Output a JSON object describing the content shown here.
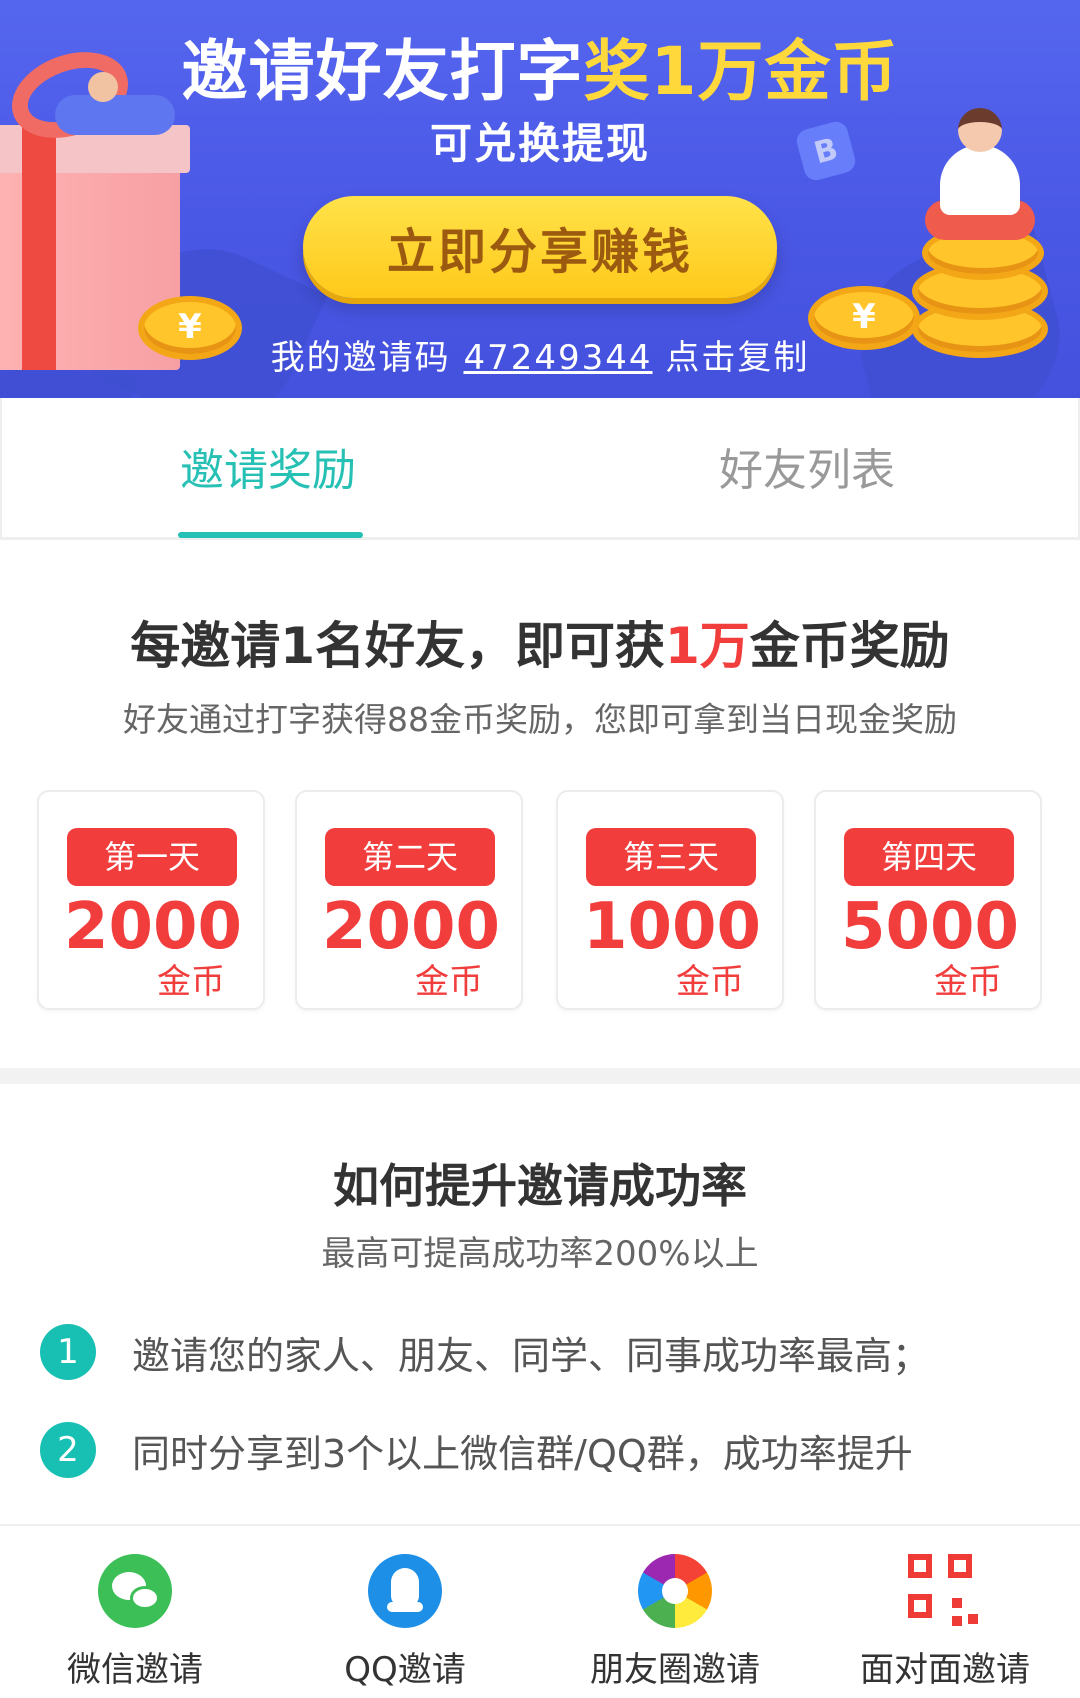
{
  "banner": {
    "title_main": "邀请好友打字",
    "title_highlight": "奖1万金币",
    "subtitle": "可兑换提现",
    "share_button": "立即分享赚钱",
    "invite_prefix": "我的邀请码",
    "invite_code": "47249344",
    "invite_suffix": "点击复制",
    "coin_symbol": "¥",
    "badge_letter": "B"
  },
  "tabs": [
    {
      "label": "邀请奖励",
      "active": true
    },
    {
      "label": "好友列表",
      "active": false
    }
  ],
  "reward": {
    "title_before": "每邀请1名好友，即可获",
    "title_highlight": "1万",
    "title_after": "金币奖励",
    "subtitle": "好友通过打字获得88金币奖励，您即可拿到当日现金奖励",
    "days": [
      {
        "label": "第一天",
        "amount": "2000",
        "unit": "金币"
      },
      {
        "label": "第二天",
        "amount": "2000",
        "unit": "金币"
      },
      {
        "label": "第三天",
        "amount": "1000",
        "unit": "金币"
      },
      {
        "label": "第四天",
        "amount": "5000",
        "unit": "金币"
      }
    ]
  },
  "tips": {
    "title": "如何提升邀请成功率",
    "subtitle": "最高可提高成功率200%以上",
    "items": [
      {
        "num": "1",
        "text": "邀请您的家人、朋友、同学、同事成功率最高；"
      },
      {
        "num": "2",
        "text": "同时分享到3个以上微信群/QQ群，成功率提升"
      }
    ]
  },
  "share_bar": [
    {
      "label": "微信邀请",
      "icon": "wechat-icon"
    },
    {
      "label": "QQ邀请",
      "icon": "qq-icon"
    },
    {
      "label": "朋友圈邀请",
      "icon": "moments-icon"
    },
    {
      "label": "面对面邀请",
      "icon": "qrcode-icon"
    }
  ],
  "colors": {
    "banner_blue": "#4a58e6",
    "accent_teal": "#27c0b4",
    "reward_red": "#f23d3d",
    "button_yellow": "#ffc91a"
  }
}
